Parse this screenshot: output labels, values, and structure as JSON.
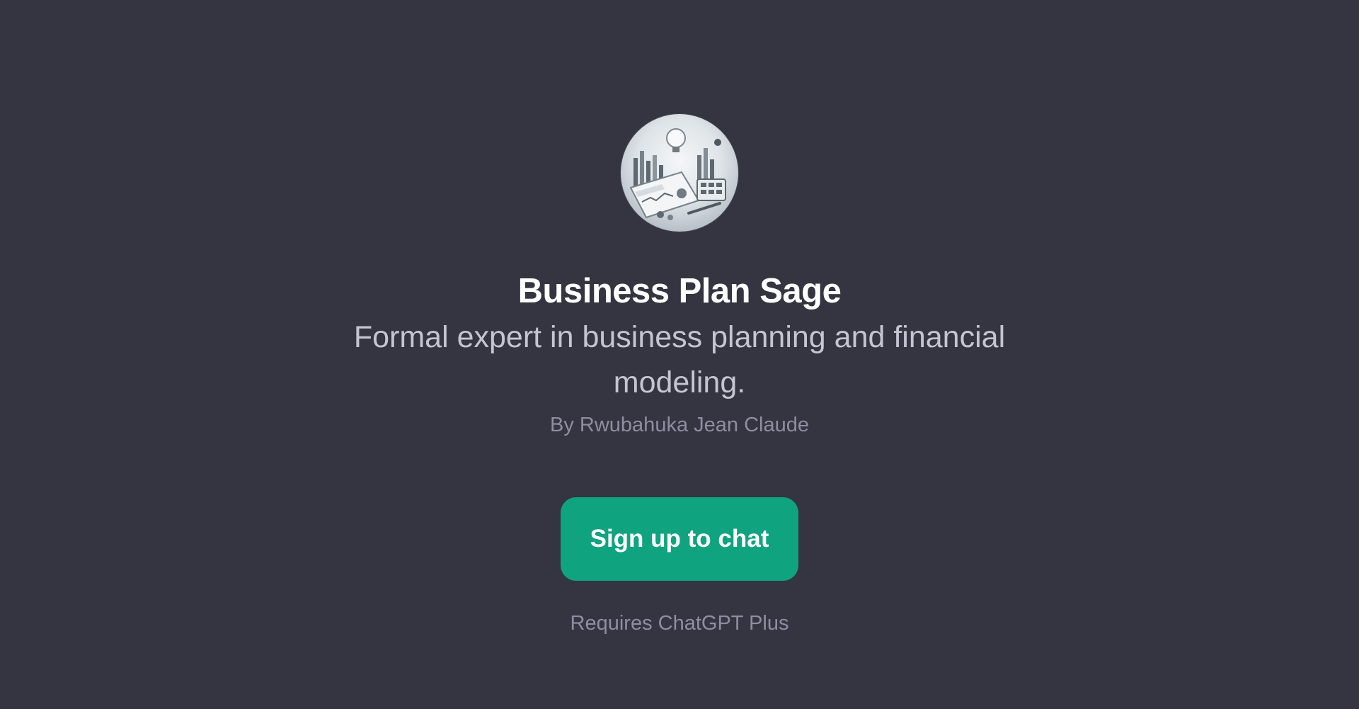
{
  "gpt": {
    "avatar_icon": "business-plan-illustration-icon",
    "name": "Business Plan Sage",
    "description": "Formal expert in business planning and financial modeling.",
    "author": "By Rwubahuka Jean Claude"
  },
  "cta": {
    "label": "Sign up to chat",
    "note": "Requires ChatGPT Plus"
  },
  "colors": {
    "background": "#343541",
    "accent": "#10a37f",
    "title": "#ffffff",
    "subtitle": "#c5c5d2",
    "muted": "#8e8ea0"
  }
}
